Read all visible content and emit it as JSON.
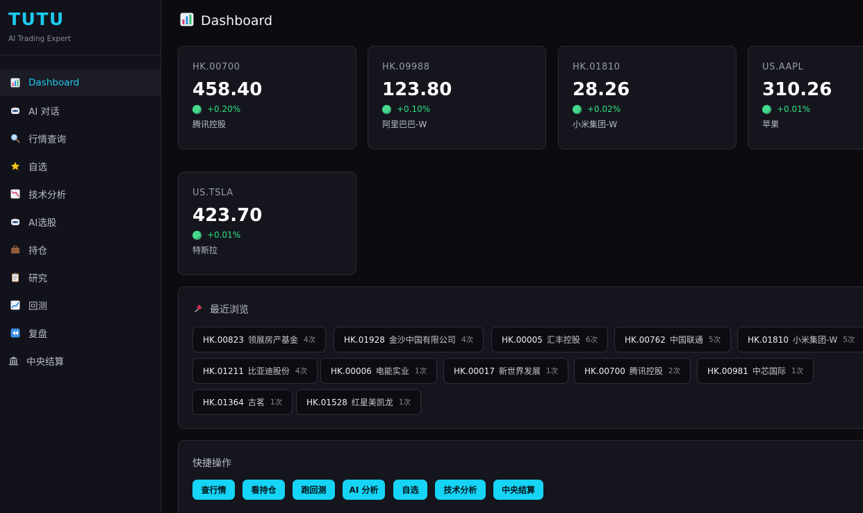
{
  "brand": {
    "name": "TUTU",
    "subtitle": "AI Trading Expert"
  },
  "sidebar": {
    "items": [
      {
        "label": "Dashboard",
        "icon": "bar-chart-icon",
        "active": true
      },
      {
        "label": "AI 对话",
        "icon": "robot-icon"
      },
      {
        "label": "行情查询",
        "icon": "magnifier-icon"
      },
      {
        "label": "自选",
        "icon": "star-icon"
      },
      {
        "label": "技术分析",
        "icon": "chart-down-icon"
      },
      {
        "label": "AI选股",
        "icon": "robot-icon"
      },
      {
        "label": "持仓",
        "icon": "briefcase-icon"
      },
      {
        "label": "研究",
        "icon": "clipboard-icon"
      },
      {
        "label": "回测",
        "icon": "chart-up-icon"
      },
      {
        "label": "复盘",
        "icon": "rewind-icon"
      },
      {
        "label": "中央结算",
        "icon": "bank-icon"
      }
    ]
  },
  "header": {
    "title": "Dashboard",
    "icon": "bar-chart-icon"
  },
  "quotes": [
    {
      "symbol": "HK.00700",
      "price": "458.40",
      "change": "+0.20%",
      "name": "腾讯控股"
    },
    {
      "symbol": "HK.09988",
      "price": "123.80",
      "change": "+0.10%",
      "name": "阿里巴巴-W"
    },
    {
      "symbol": "HK.01810",
      "price": "28.26",
      "change": "+0.02%",
      "name": "小米集团-W"
    },
    {
      "symbol": "US.AAPL",
      "price": "310.26",
      "change": "+0.01%",
      "name": "苹果"
    },
    {
      "symbol": "US.TSLA",
      "price": "423.70",
      "change": "+0.01%",
      "name": "特斯拉"
    }
  ],
  "recent": {
    "title": "最近浏览",
    "icon": "pushpin-icon",
    "items": [
      {
        "symbol": "HK.00823",
        "name": "领展房产基金",
        "count": "4次"
      },
      {
        "symbol": "HK.01928",
        "name": "金沙中国有限公司",
        "count": "4次"
      },
      {
        "symbol": "HK.00005",
        "name": "汇丰控股",
        "count": "6次"
      },
      {
        "symbol": "HK.00762",
        "name": "中国联通",
        "count": "5次"
      },
      {
        "symbol": "HK.01810",
        "name": "小米集团-W",
        "count": "5次"
      },
      {
        "symbol": "HK.01211",
        "name": "比亚迪股份",
        "count": "4次"
      },
      {
        "symbol": "HK.00006",
        "name": "电能实业",
        "count": "1次"
      },
      {
        "symbol": "HK.00017",
        "name": "新世界发展",
        "count": "1次"
      },
      {
        "symbol": "HK.00700",
        "name": "腾讯控股",
        "count": "2次"
      },
      {
        "symbol": "HK.00981",
        "name": "中芯国际",
        "count": "1次"
      },
      {
        "symbol": "HK.01364",
        "name": "古茗",
        "count": "1次"
      },
      {
        "symbol": "HK.01528",
        "name": "红星美凯龙",
        "count": "1次"
      }
    ]
  },
  "quick_actions": {
    "title": "快捷操作",
    "buttons": [
      "查行情",
      "看持仓",
      "跑回测",
      "AI 分析",
      "自选",
      "技术分析",
      "中央结算"
    ]
  },
  "colors": {
    "accent": "#1ec8ef",
    "positive": "#2fe082",
    "button": "#15d4f5"
  }
}
